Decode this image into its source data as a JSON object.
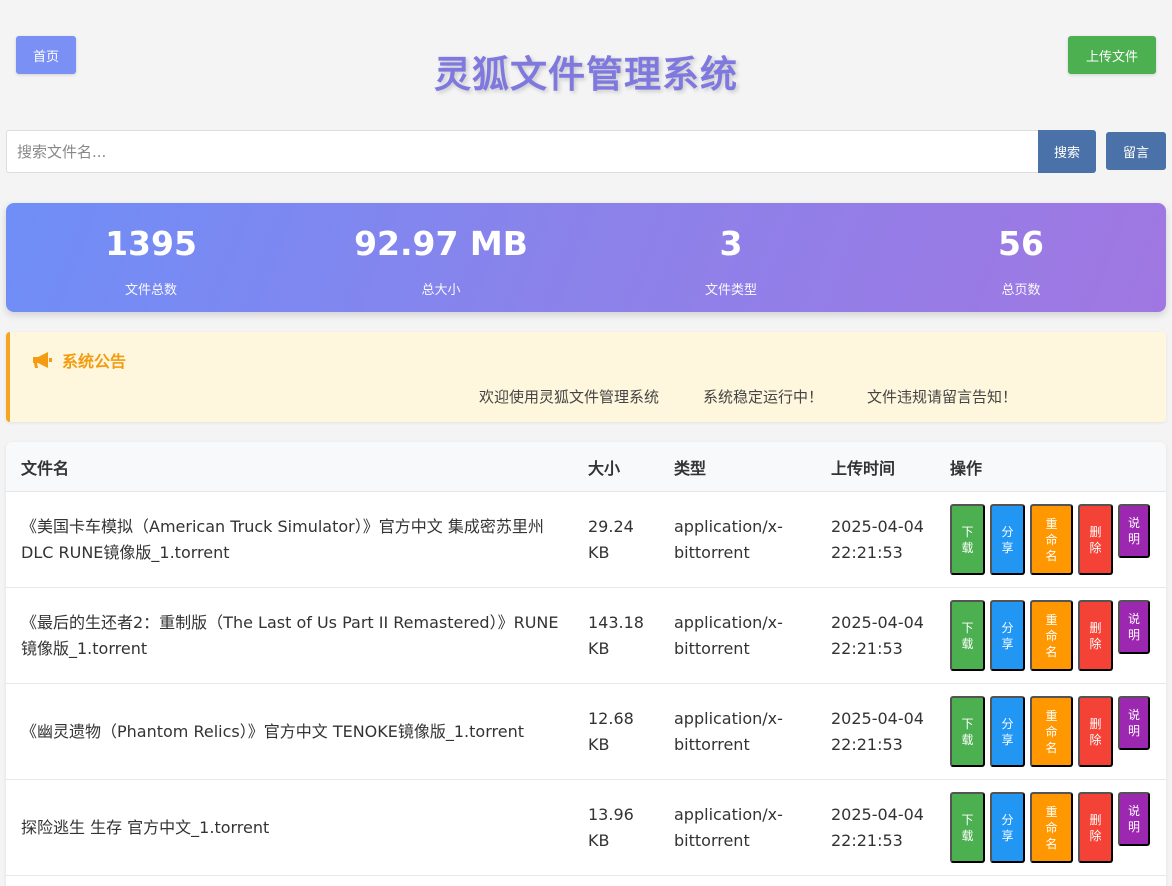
{
  "header": {
    "home_label": "首页",
    "title": "灵狐文件管理系统",
    "upload_label": "上传文件"
  },
  "search": {
    "placeholder": "搜索文件名...",
    "button_label": "搜索",
    "message_label": "留言"
  },
  "stats": [
    {
      "value": "1395",
      "label": "文件总数"
    },
    {
      "value": "92.97 MB",
      "label": "总大小"
    },
    {
      "value": "3",
      "label": "文件类型"
    },
    {
      "value": "56",
      "label": "总页数"
    }
  ],
  "notice": {
    "title": "系统公告",
    "items": [
      "欢迎使用灵狐文件管理系统",
      "系统稳定运行中！",
      "文件违规请留言告知！"
    ]
  },
  "table": {
    "headers": {
      "name": "文件名",
      "size": "大小",
      "type": "类型",
      "time": "上传时间",
      "actions": "操作"
    },
    "action_labels": {
      "download": "下载",
      "share": "分享",
      "rename": "重命名",
      "delete": "删除",
      "info": "说明"
    },
    "rows": [
      {
        "name": "《美国卡车模拟（American Truck Simulator）》官方中文 集成密苏里州DLC RUNE镜像版_1.torrent",
        "size": "29.24 KB",
        "type": "application/x-bittorrent",
        "time": "2025-04-04 22:21:53"
      },
      {
        "name": "《最后的生还者2：重制版（The Last of Us Part II Remastered）》RUNE镜像版_1.torrent",
        "size": "143.18 KB",
        "type": "application/x-bittorrent",
        "time": "2025-04-04 22:21:53"
      },
      {
        "name": "《幽灵遗物（Phantom Relics）》官方中文 TENOKE镜像版_1.torrent",
        "size": "12.68 KB",
        "type": "application/x-bittorrent",
        "time": "2025-04-04 22:21:53"
      },
      {
        "name": "探险逃生 生存 官方中文_1.torrent",
        "size": "13.96 KB",
        "type": "application/x-bittorrent",
        "time": "2025-04-04 22:21:53"
      }
    ]
  }
}
